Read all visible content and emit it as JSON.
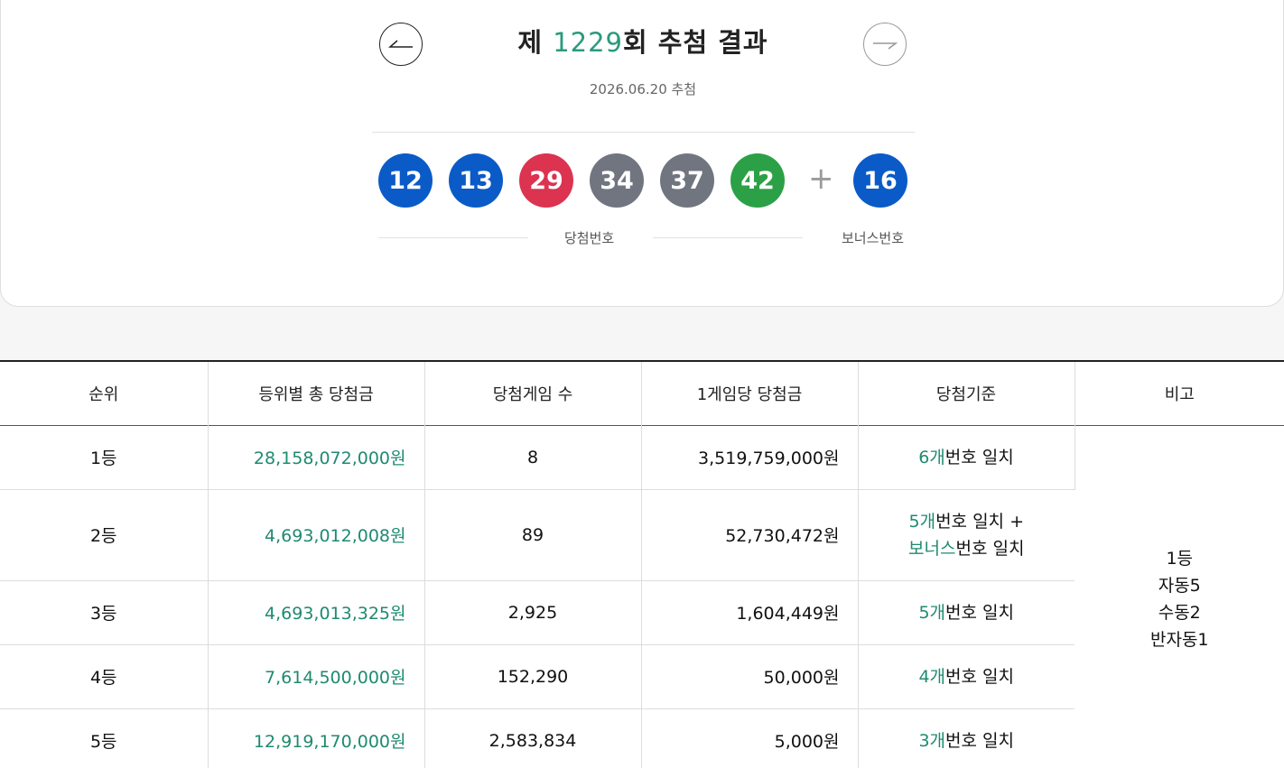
{
  "header": {
    "title_prefix": "제 ",
    "round": "1229",
    "title_suffix": "회 추첨 결과",
    "draw_date": "2026.06.20 추첨"
  },
  "balls": {
    "winning": [
      {
        "number": "12",
        "color": "#0a5bc7"
      },
      {
        "number": "13",
        "color": "#0a5bc7"
      },
      {
        "number": "29",
        "color": "#dc3350"
      },
      {
        "number": "34",
        "color": "#707580"
      },
      {
        "number": "37",
        "color": "#707580"
      },
      {
        "number": "42",
        "color": "#2ca046"
      }
    ],
    "plus": "+",
    "bonus": {
      "number": "16",
      "color": "#0a5bc7"
    },
    "winning_label": "당첨번호",
    "bonus_label": "보너스번호"
  },
  "table": {
    "headers": [
      "순위",
      "등위별 총 당첨금",
      "당첨게임 수",
      "1게임당 당첨금",
      "당첨기준",
      "비고"
    ],
    "rows": [
      {
        "rank": "1등",
        "total": "28,158,072,000원",
        "count": "8",
        "per_game": "3,519,759,000원",
        "crit_num": "6개",
        "crit_text": "번호 일치"
      },
      {
        "rank": "2등",
        "total": "4,693,012,008원",
        "count": "89",
        "per_game": "52,730,472원",
        "crit_num": "5개",
        "crit_text": "번호 일치 +",
        "crit_bonus": "보너스",
        "crit_bonus_text": "번호 일치"
      },
      {
        "rank": "3등",
        "total": "4,693,013,325원",
        "count": "2,925",
        "per_game": "1,604,449원",
        "crit_num": "5개",
        "crit_text": "번호 일치"
      },
      {
        "rank": "4등",
        "total": "7,614,500,000원",
        "count": "152,290",
        "per_game": "50,000원",
        "crit_num": "4개",
        "crit_text": "번호 일치"
      },
      {
        "rank": "5등",
        "total": "12,919,170,000원",
        "count": "2,583,834",
        "per_game": "5,000원",
        "crit_num": "3개",
        "crit_text": "번호 일치"
      }
    ],
    "remark": [
      "1등",
      "자동5",
      "수동2",
      "반자동1"
    ]
  }
}
